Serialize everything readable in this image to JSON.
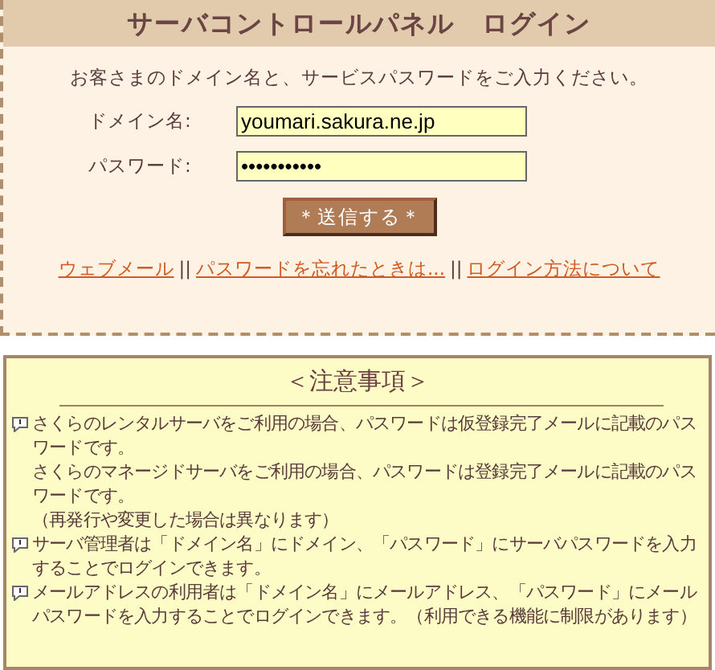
{
  "login_panel": {
    "title": "サーバコントロールパネル　ログイン",
    "instruction": "お客さまのドメイン名と、サービスパスワードをご入力ください。",
    "fields": [
      {
        "label": "ドメイン名:",
        "value": "youmari.sakura.ne.jp"
      },
      {
        "label": "パスワード:",
        "value": "•••••••••••"
      }
    ],
    "submit_button": "＊送信する＊",
    "links": [
      "ウェブメール",
      "パスワードを忘れたときは...",
      "ログイン方法について"
    ],
    "link_separators": [
      "||",
      "||"
    ]
  },
  "notice": {
    "title": "＜注意事項＞",
    "items": [
      {
        "lines": [
          "さくらのレンタルサーバをご利用の場合、パスワードは仮登録完了メールに記載のパスワードです。",
          "さくらのマネージドサーバをご利用の場合、パスワードは登録完了メールに記載のパスワードです。",
          "（再発行や変更した場合は異なります）"
        ]
      },
      {
        "lines": [
          "サーバ管理者は「ドメイン名」にドメイン、「パスワード」にサーバパスワードを入力することでログインできます。"
        ]
      },
      {
        "lines": [
          "メールアドレスの利用者は「ドメイン名」にメールアドレス、「パスワード」にメールパスワードを入力することでログインできます。（利用できる機能に制限があります）"
        ]
      }
    ]
  }
}
